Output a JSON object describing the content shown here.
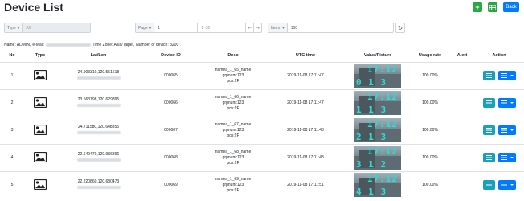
{
  "header": {
    "title": "Device List",
    "add_label": "+",
    "back_label": "Back"
  },
  "filters": {
    "type_label": "Type",
    "type_value": "All",
    "page_label": "Page",
    "page_value": "1",
    "page_range": "1~32",
    "prev_glyph": "←",
    "next_glyph": "→",
    "items_label": "Items",
    "items_value": "100",
    "refresh_glyph": "↻"
  },
  "info": {
    "name_text": "Name: ADMIN,",
    "email_label": "e-Mail:",
    "timezone": "Time Zone: Asia/Taipei,",
    "device_count": "Number of device: 3200"
  },
  "table": {
    "headers": [
      "No",
      "Type",
      "Lat/Lon",
      "Device ID",
      "Desc",
      "UTC time",
      "Value/Picture",
      "Usage rate",
      "Alert",
      "Action"
    ],
    "rows": [
      {
        "no": "1",
        "latlon": "24.903310,120.551518",
        "device_id": "000065",
        "desc_name": "namea_1_65_name",
        "desc_grp": "grpnum:123",
        "desc_pos": "pos:2F",
        "utc": "2019-11-08 17:11:47",
        "pic_time": "17:12",
        "pic_val": "0 1 3",
        "usage": "100.00%"
      },
      {
        "no": "2",
        "latlon": "23.563798,120.629895",
        "device_id": "000066",
        "desc_name": "namea_1_66_name",
        "desc_grp": "grpnum:123",
        "desc_pos": "pos:2F",
        "utc": "2019-11-08 17:11:47",
        "pic_time": "17:12",
        "pic_val": "1 1 3",
        "usage": "100.00%"
      },
      {
        "no": "3",
        "latlon": "24.711580,120.648355",
        "device_id": "000067",
        "desc_name": "namea_1_67_name",
        "desc_grp": "grpnum:123",
        "desc_pos": "pos:2F",
        "utc": "2019-11-08 17:11:48",
        "pic_time": "17:12",
        "pic_val": "2 1 3",
        "usage": "100.00%"
      },
      {
        "no": "4",
        "latlon": "22.649470,120.936396",
        "device_id": "000068",
        "desc_name": "namea_1_68_name",
        "desc_grp": "grpnum:123",
        "desc_pos": "pos:2F",
        "utc": "2019-11-08 17:11:48",
        "pic_time": "17:12",
        "pic_val": "3 1 2",
        "usage": "100.00%"
      },
      {
        "no": "5",
        "latlon": "22.220860,120.680473",
        "device_id": "000069",
        "desc_name": "namea_1_69_name",
        "desc_grp": "grpnum:123",
        "desc_pos": "pos:2F",
        "utc": "2019-11-08 17:11:51",
        "pic_time": "17:12",
        "pic_val": "4 1 3",
        "usage": "100.00%"
      }
    ]
  },
  "icons": {
    "add": "plus-icon",
    "grid": "grid-icon",
    "type": "image-icon",
    "list": "list-icon",
    "menu": "menu-icon"
  },
  "colors": {
    "success": "#28a745",
    "primary": "#007bff",
    "info": "#17a2b8",
    "digits": "#27e0d4"
  }
}
